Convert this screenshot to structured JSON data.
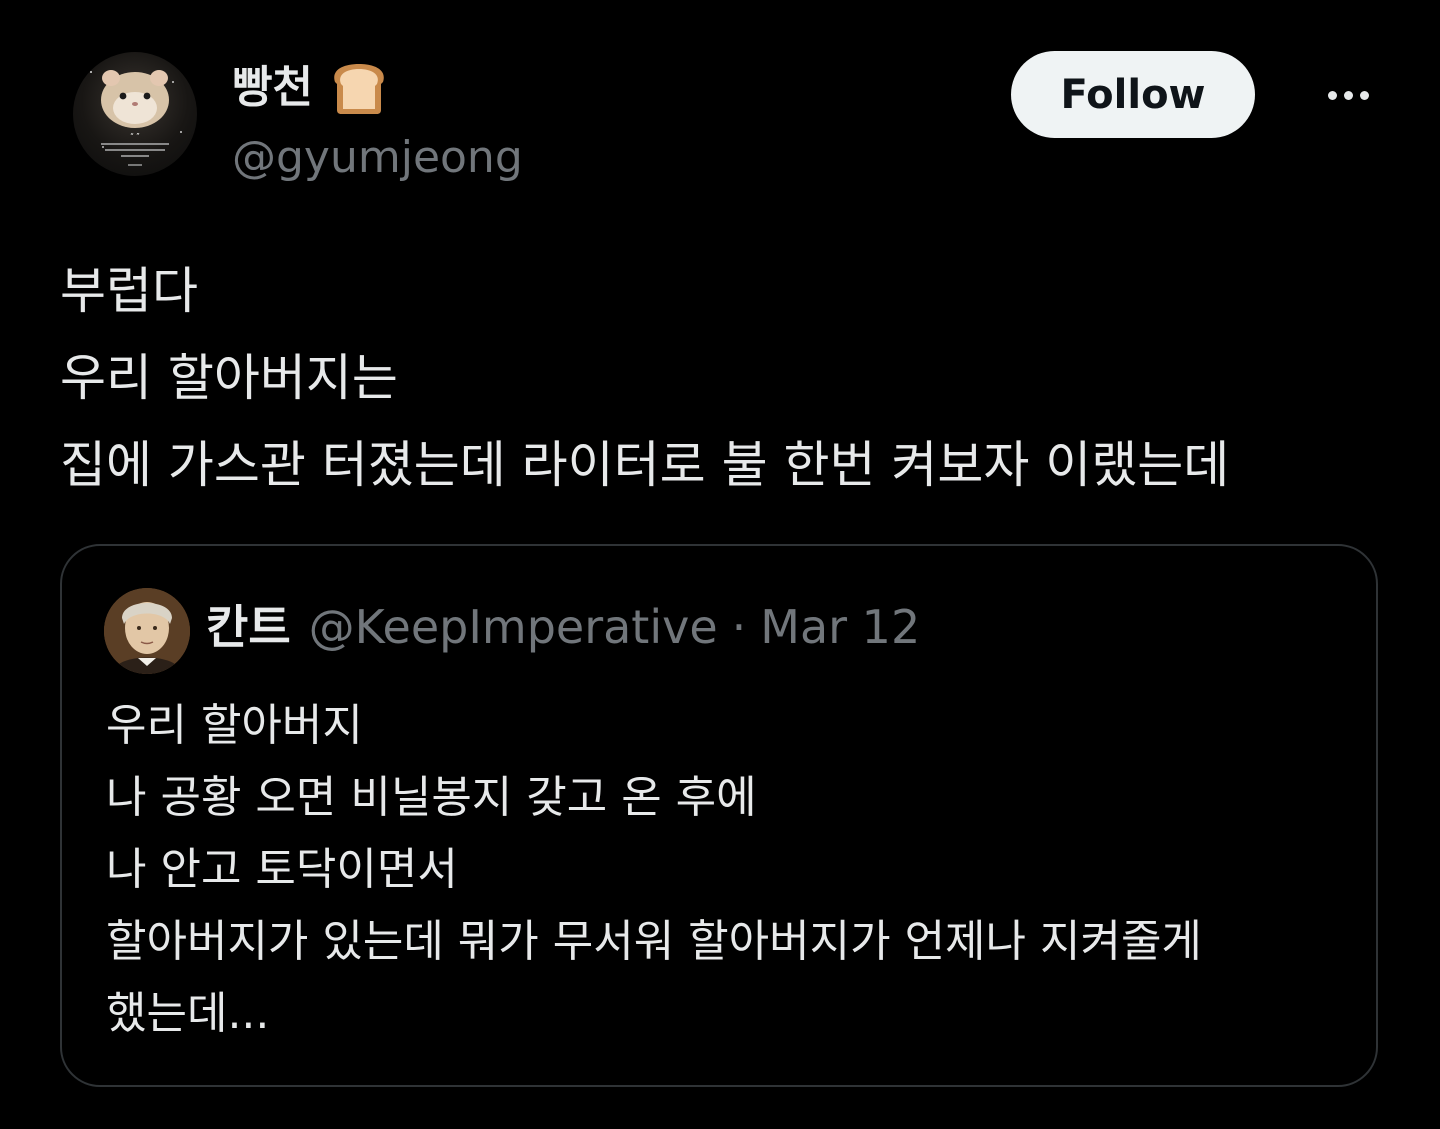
{
  "author": {
    "display_name": "빵천",
    "name_emoji_icon": "bread-icon",
    "handle": "@gyumjeong",
    "avatar_icon": "hamster-avatar"
  },
  "actions": {
    "follow_label": "Follow",
    "more_icon": "more-dots-icon"
  },
  "tweet": {
    "lines": [
      "부럽다",
      "우리 할아버지는",
      "집에 가스관 터졌는데 라이터로 불 한번 켜보자 이랬는데"
    ]
  },
  "quoted_tweet": {
    "display_name": "칸트",
    "handle": "@KeepImperative",
    "separator": "·",
    "date": "Mar 12",
    "avatar_icon": "portrait-avatar",
    "lines": [
      "우리 할아버지",
      "나 공황 오면 비닐봉지 갖고 온 후에",
      "나 안고 토닥이면서",
      "할아버지가 있는데 뭐가 무서워 할아버지가 언제나 지켜줄게",
      "했는데..."
    ]
  },
  "colors": {
    "background": "#000000",
    "text_primary": "#e7e9ea",
    "text_secondary": "#71767b",
    "border": "#2f3336",
    "follow_bg": "#eff3f4"
  }
}
